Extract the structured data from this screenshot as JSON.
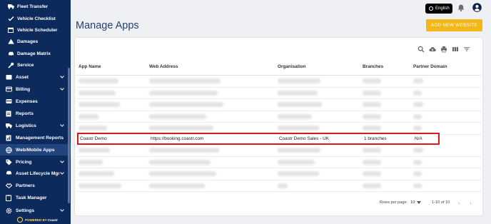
{
  "sidebar": {
    "items": [
      {
        "label": "Fleet Transfer",
        "icon": "truck-icon",
        "sub": true
      },
      {
        "label": "Vehicle Checklist",
        "icon": "checklist-icon",
        "sub": true
      },
      {
        "label": "Vehicle Scheduler",
        "icon": "calendar-icon",
        "sub": true
      },
      {
        "label": "Damages",
        "icon": "warning-icon",
        "sub": true
      },
      {
        "label": "Damage Matrix",
        "icon": "car-icon",
        "sub": true
      },
      {
        "label": "Service",
        "icon": "wrench-icon",
        "sub": true
      },
      {
        "label": "Asset",
        "icon": "asset-icon",
        "chevron": true
      },
      {
        "label": "Billing",
        "icon": "billing-icon",
        "chevron": true
      },
      {
        "label": "Expenses",
        "icon": "expenses-icon"
      },
      {
        "label": "Reports",
        "icon": "reports-icon"
      },
      {
        "label": "Logistics",
        "icon": "logistics-icon",
        "chevron": true
      },
      {
        "label": "Management Reports",
        "icon": "management-reports-icon"
      },
      {
        "label": "Web/Mobile Apps",
        "icon": "globe-icon",
        "active": true
      },
      {
        "label": "Pricing",
        "icon": "tag-icon",
        "chevron": true
      },
      {
        "label": "Asset Lifecycle Mgmt",
        "icon": "lifecycle-icon",
        "chevron": true
      },
      {
        "label": "Partners",
        "icon": "partners-icon"
      },
      {
        "label": "Task Manager",
        "icon": "task-icon"
      },
      {
        "label": "Settings",
        "icon": "gear-icon",
        "chevron": true
      }
    ],
    "powered_by": "POWERED BY",
    "powered_brand": "Coastr"
  },
  "topbar": {
    "language": "English",
    "bell_icon": "bell-icon",
    "user_icon": "user-icon"
  },
  "page": {
    "title": "Manage Apps",
    "add_button": "ADD NEW WEBSITE"
  },
  "toolbar": [
    "search-icon",
    "cloud-download-icon",
    "print-icon",
    "columns-icon",
    "filter-icon"
  ],
  "table": {
    "headers": [
      "App Name",
      "Web Address",
      "Organisation",
      "Branches",
      "Partner Domain"
    ],
    "highlighted_row": {
      "app_name": "Coastr Demo",
      "web_address": "https://booking.coastr.com",
      "organisation": "Coastr Demo Sales - UK",
      "branches": "1 branches",
      "partner_domain": "N/A"
    },
    "highlight_color": "#d8181e"
  },
  "pagination": {
    "rows_per_page_label": "Rows per page:",
    "rows_per_page_value": "10",
    "range": "1-10 of 10"
  },
  "colors": {
    "sidebar": "#0d2a5c",
    "sidebar_active": "#21447d",
    "accent": "#f4b718",
    "title": "#28406e"
  }
}
